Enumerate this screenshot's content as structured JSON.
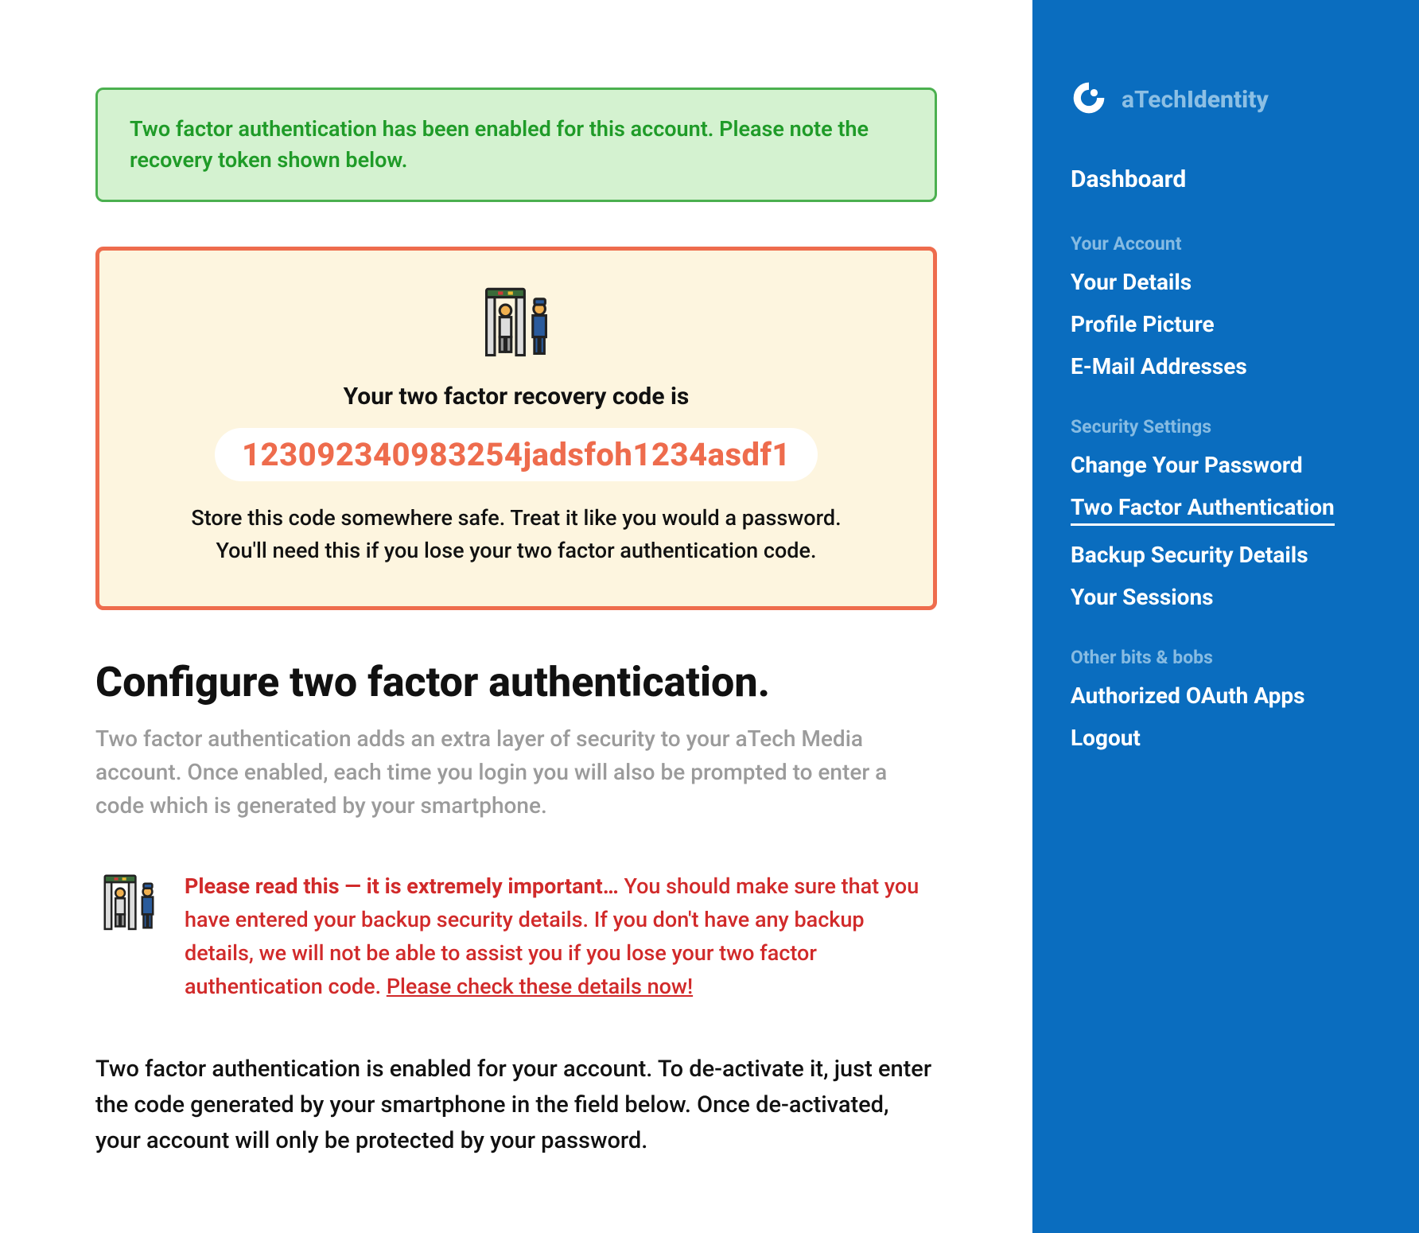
{
  "alert": {
    "success_text": "Two factor authentication has been enabled for this account. Please note the recovery token shown below."
  },
  "recovery": {
    "title": "Your two factor recovery code is",
    "code": "123092340983254jadsfoh1234asdf1",
    "note": "Store this code somewhere safe. Treat it like you would a password. You'll need this if you lose your two factor authentication code."
  },
  "page": {
    "title": "Configure two factor authentication.",
    "subtitle": "Two factor authentication adds an extra layer of security to your aTech Media account. Once enabled, each time you login you will also be prompted to enter a code which is generated by your smartphone."
  },
  "warning": {
    "strong": "Please read this — it is extremely important…",
    "body": " You should make sure that you have entered your backup security details. If you don't have any backup details, we will not be able to assist you if you lose your two factor authentication code. ",
    "link_text": "Please check these details now!"
  },
  "deactivate": {
    "text": "Two factor authentication is enabled for your account. To de-activate it, just enter the code generated by your smartphone in the field below. Once de-activated, your account will only be protected by your password."
  },
  "sidebar": {
    "brand_prefix": "aTech",
    "brand_suffix": "Identity",
    "dashboard": "Dashboard",
    "sections": {
      "account": {
        "label": "Your Account",
        "items": [
          "Your Details",
          "Profile Picture",
          "E-Mail Addresses"
        ]
      },
      "security": {
        "label": "Security Settings",
        "items": [
          "Change Your Password",
          "Two Factor Authentication",
          "Backup Security Details",
          "Your Sessions"
        ]
      },
      "other": {
        "label": "Other bits & bobs",
        "items": [
          "Authorized OAuth Apps",
          "Logout"
        ]
      }
    }
  }
}
